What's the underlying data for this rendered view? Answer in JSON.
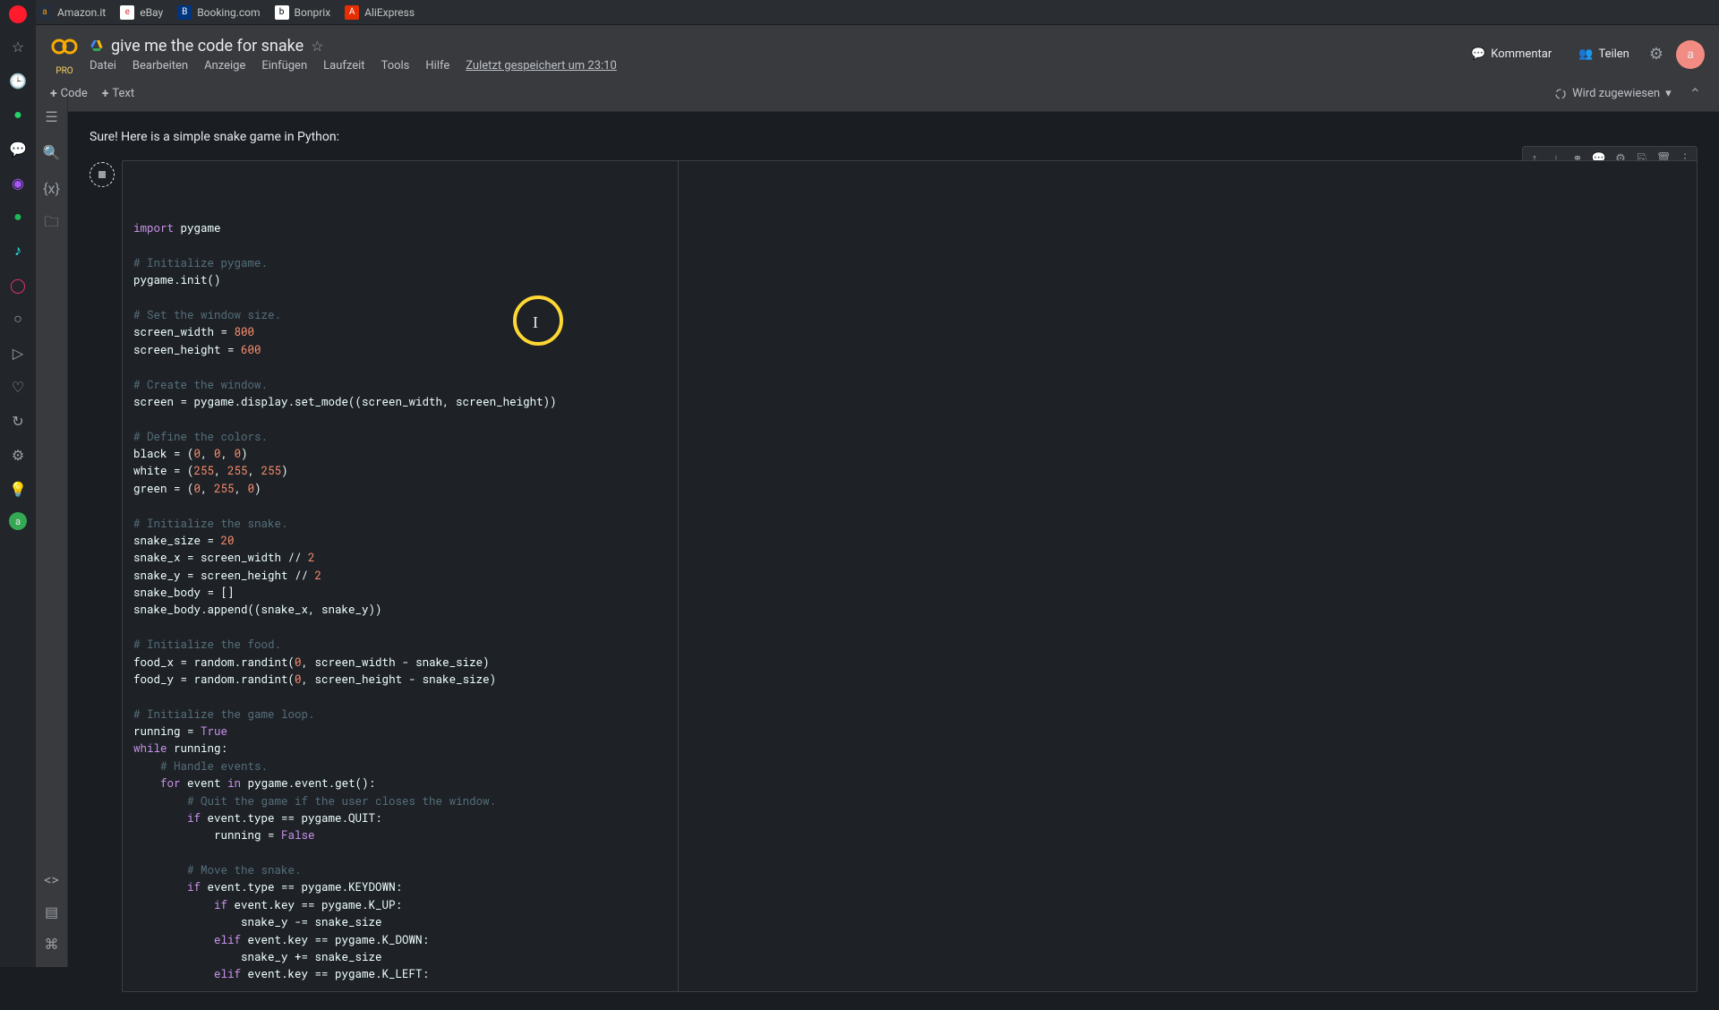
{
  "bookmarks": [
    {
      "label": "Amazon.it",
      "color": "#232f3e",
      "letter": "a"
    },
    {
      "label": "eBay",
      "color": "#fff",
      "letter": "e"
    },
    {
      "label": "Booking.com",
      "color": "#003580",
      "letter": "B"
    },
    {
      "label": "Bonprix",
      "color": "#fff",
      "letter": "b"
    },
    {
      "label": "AliExpress",
      "color": "#e62e04",
      "letter": "A"
    }
  ],
  "doc": {
    "title": "give me the code for snake",
    "pro": "PRO",
    "menus": [
      "Datei",
      "Bearbeiten",
      "Anzeige",
      "Einfügen",
      "Laufzeit",
      "Tools",
      "Hilfe"
    ],
    "autosave": "Zuletzt gespeichert um 23:10"
  },
  "header_right": {
    "comment": "Kommentar",
    "share": "Teilen",
    "user_initial": "a"
  },
  "toolbar": {
    "code": "Code",
    "text": "Text",
    "assign": "Wird zugewiesen"
  },
  "intro": "Sure! Here is a simple snake game in Python:",
  "code_lines": [
    [
      {
        "t": "import ",
        "c": "kw"
      },
      {
        "t": "pygame",
        "c": "id"
      }
    ],
    [],
    [
      {
        "t": "# Initialize pygame.",
        "c": "cmt"
      }
    ],
    [
      {
        "t": "pygame.init()",
        "c": "id"
      }
    ],
    [],
    [
      {
        "t": "# Set the window size.",
        "c": "cmt"
      }
    ],
    [
      {
        "t": "screen_width = ",
        "c": "id"
      },
      {
        "t": "800",
        "c": "num"
      }
    ],
    [
      {
        "t": "screen_height = ",
        "c": "id"
      },
      {
        "t": "600",
        "c": "num"
      }
    ],
    [],
    [
      {
        "t": "# Create the window.",
        "c": "cmt"
      }
    ],
    [
      {
        "t": "screen = pygame.display.set_mode((screen_width, screen_height))",
        "c": "id"
      }
    ],
    [],
    [
      {
        "t": "# Define the colors.",
        "c": "cmt"
      }
    ],
    [
      {
        "t": "black = (",
        "c": "id"
      },
      {
        "t": "0",
        "c": "num"
      },
      {
        "t": ", ",
        "c": "id"
      },
      {
        "t": "0",
        "c": "num"
      },
      {
        "t": ", ",
        "c": "id"
      },
      {
        "t": "0",
        "c": "num"
      },
      {
        "t": ")",
        "c": "id"
      }
    ],
    [
      {
        "t": "white = (",
        "c": "id"
      },
      {
        "t": "255",
        "c": "num"
      },
      {
        "t": ", ",
        "c": "id"
      },
      {
        "t": "255",
        "c": "num"
      },
      {
        "t": ", ",
        "c": "id"
      },
      {
        "t": "255",
        "c": "num"
      },
      {
        "t": ")",
        "c": "id"
      }
    ],
    [
      {
        "t": "green = (",
        "c": "id"
      },
      {
        "t": "0",
        "c": "num"
      },
      {
        "t": ", ",
        "c": "id"
      },
      {
        "t": "255",
        "c": "num"
      },
      {
        "t": ", ",
        "c": "id"
      },
      {
        "t": "0",
        "c": "num"
      },
      {
        "t": ")",
        "c": "id"
      }
    ],
    [],
    [
      {
        "t": "# Initialize the snake.",
        "c": "cmt"
      }
    ],
    [
      {
        "t": "snake_size = ",
        "c": "id"
      },
      {
        "t": "20",
        "c": "num"
      }
    ],
    [
      {
        "t": "snake_x = screen_width // ",
        "c": "id"
      },
      {
        "t": "2",
        "c": "num"
      }
    ],
    [
      {
        "t": "snake_y = screen_height // ",
        "c": "id"
      },
      {
        "t": "2",
        "c": "num"
      }
    ],
    [
      {
        "t": "snake_body = []",
        "c": "id"
      }
    ],
    [
      {
        "t": "snake_body.append((snake_x, snake_y))",
        "c": "id"
      }
    ],
    [],
    [
      {
        "t": "# Initialize the food.",
        "c": "cmt"
      }
    ],
    [
      {
        "t": "food_x = random.randint(",
        "c": "id"
      },
      {
        "t": "0",
        "c": "num"
      },
      {
        "t": ", screen_width - snake_size)",
        "c": "id"
      }
    ],
    [
      {
        "t": "food_y = random.randint(",
        "c": "id"
      },
      {
        "t": "0",
        "c": "num"
      },
      {
        "t": ", screen_height - snake_size)",
        "c": "id"
      }
    ],
    [],
    [
      {
        "t": "# Initialize the game loop.",
        "c": "cmt"
      }
    ],
    [
      {
        "t": "running = ",
        "c": "id"
      },
      {
        "t": "True",
        "c": "bool"
      }
    ],
    [
      {
        "t": "while ",
        "c": "kw"
      },
      {
        "t": "running:",
        "c": "id"
      }
    ],
    [
      {
        "t": "    ",
        "c": "id"
      },
      {
        "t": "# Handle events.",
        "c": "cmt"
      }
    ],
    [
      {
        "t": "    ",
        "c": "id"
      },
      {
        "t": "for ",
        "c": "kw"
      },
      {
        "t": "event ",
        "c": "id"
      },
      {
        "t": "in ",
        "c": "kw"
      },
      {
        "t": "pygame.event.get():",
        "c": "id"
      }
    ],
    [
      {
        "t": "        ",
        "c": "id"
      },
      {
        "t": "# Quit the game if the user closes the window.",
        "c": "cmt"
      }
    ],
    [
      {
        "t": "        ",
        "c": "id"
      },
      {
        "t": "if ",
        "c": "kw"
      },
      {
        "t": "event.type == pygame.QUIT:",
        "c": "id"
      }
    ],
    [
      {
        "t": "            running = ",
        "c": "id"
      },
      {
        "t": "False",
        "c": "bool"
      }
    ],
    [],
    [
      {
        "t": "        ",
        "c": "id"
      },
      {
        "t": "# Move the snake.",
        "c": "cmt"
      }
    ],
    [
      {
        "t": "        ",
        "c": "id"
      },
      {
        "t": "if ",
        "c": "kw"
      },
      {
        "t": "event.type == pygame.KEYDOWN:",
        "c": "id"
      }
    ],
    [
      {
        "t": "            ",
        "c": "id"
      },
      {
        "t": "if ",
        "c": "kw"
      },
      {
        "t": "event.key == pygame.K_UP:",
        "c": "id"
      }
    ],
    [
      {
        "t": "                snake_y -= snake_size",
        "c": "id"
      }
    ],
    [
      {
        "t": "            ",
        "c": "id"
      },
      {
        "t": "elif ",
        "c": "kw"
      },
      {
        "t": "event.key == pygame.K_DOWN:",
        "c": "id"
      }
    ],
    [
      {
        "t": "                snake_y += snake_size",
        "c": "id"
      }
    ],
    [
      {
        "t": "            ",
        "c": "id"
      },
      {
        "t": "elif ",
        "c": "kw"
      },
      {
        "t": "event.key == pygame.K_LEFT:",
        "c": "id"
      }
    ]
  ]
}
